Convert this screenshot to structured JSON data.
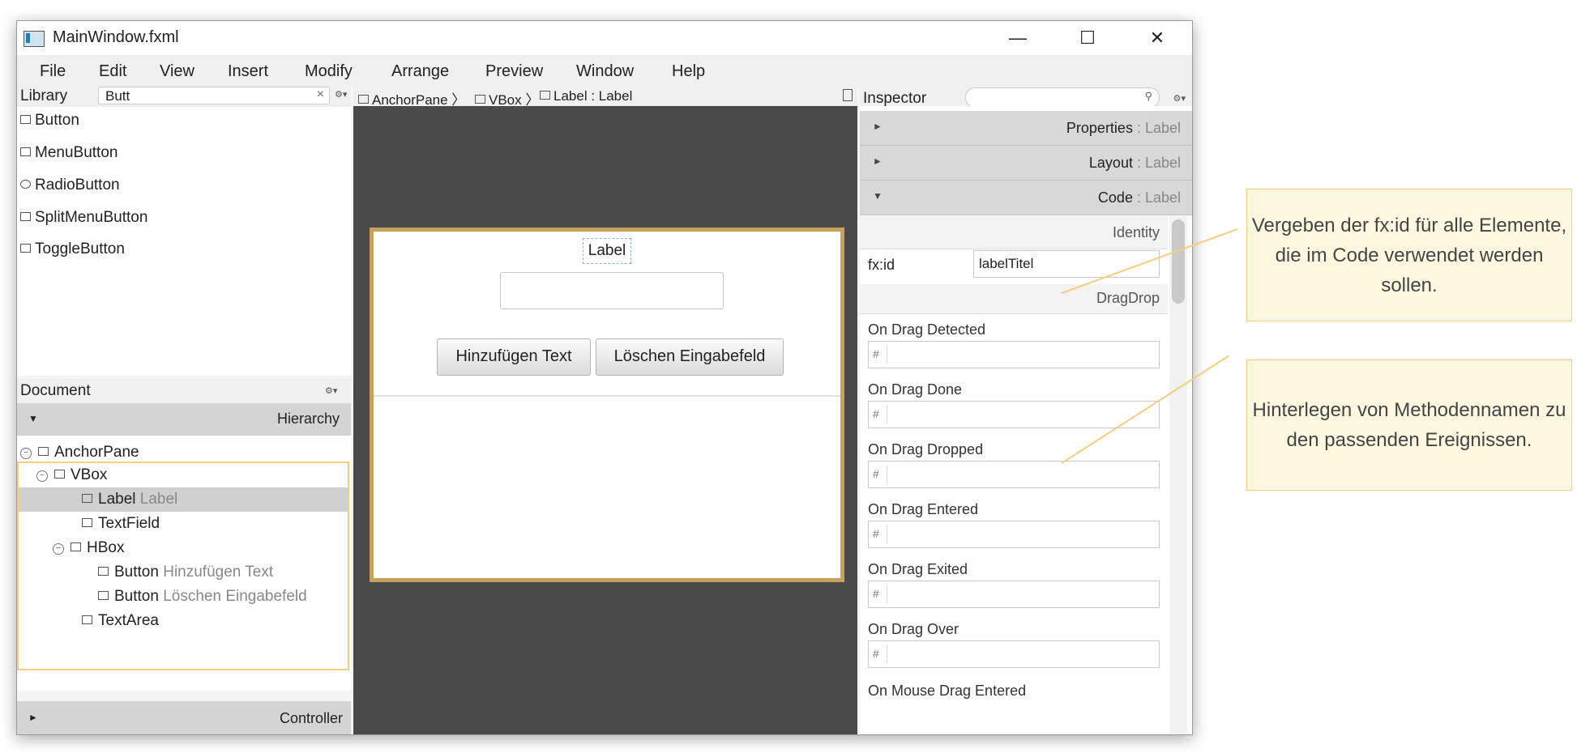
{
  "window": {
    "title": "MainWindow.fxml",
    "controls": {
      "minimize": "—",
      "maximize": "☐",
      "close": "✕"
    }
  },
  "menu": [
    "File",
    "Edit",
    "View",
    "Insert",
    "Modify",
    "Arrange",
    "Preview",
    "Window",
    "Help"
  ],
  "library": {
    "title": "Library",
    "search_value": "Butt",
    "clear": "×",
    "gear": "⚙▾",
    "items": [
      "Button",
      "MenuButton",
      "RadioButton",
      "SplitMenuButton",
      "ToggleButton"
    ]
  },
  "document": {
    "title": "Document",
    "gear": "⚙▾",
    "hierarchy_label": "Hierarchy",
    "controller_label": "Controller",
    "tree": [
      {
        "type": "AnchorPane",
        "detail": ""
      },
      {
        "type": "VBox",
        "detail": ""
      },
      {
        "type": "Label",
        "detail": "Label"
      },
      {
        "type": "TextField",
        "detail": ""
      },
      {
        "type": "HBox",
        "detail": ""
      },
      {
        "type": "Button",
        "detail": "Hinzufügen Text"
      },
      {
        "type": "Button",
        "detail": "Löschen Eingabefeld"
      },
      {
        "type": "TextArea",
        "detail": ""
      }
    ]
  },
  "breadcrumb": {
    "items": [
      "AnchorPane",
      "VBox",
      "Label : Label"
    ]
  },
  "canvas": {
    "label": "Label",
    "button_add": "Hinzufügen Text",
    "button_clear": "Löschen Eingabefeld"
  },
  "inspector": {
    "title": "Inspector",
    "search_icon": "⚲",
    "gear": "⚙▾",
    "sections": [
      {
        "name": "Properties",
        "target": " : Label"
      },
      {
        "name": "Layout",
        "target": " : Label"
      },
      {
        "name": "Code",
        "target": " : Label"
      }
    ],
    "identity_header": "Identity",
    "fxid_label": "fx:id",
    "fxid_value": "labelTitel",
    "dragdrop_header": "DragDrop",
    "events": [
      "On Drag Detected",
      "On Drag Done",
      "On Drag Dropped",
      "On Drag Entered",
      "On Drag Exited",
      "On Drag Over",
      "On Mouse Drag Entered"
    ],
    "hash": "#"
  },
  "callouts": {
    "fxid": "Vergeben der fx:id für alle Elemente, die im Code verwendet werden sollen.",
    "methods": "Hinterlegen von Methodennamen zu den passenden Ereignissen."
  }
}
